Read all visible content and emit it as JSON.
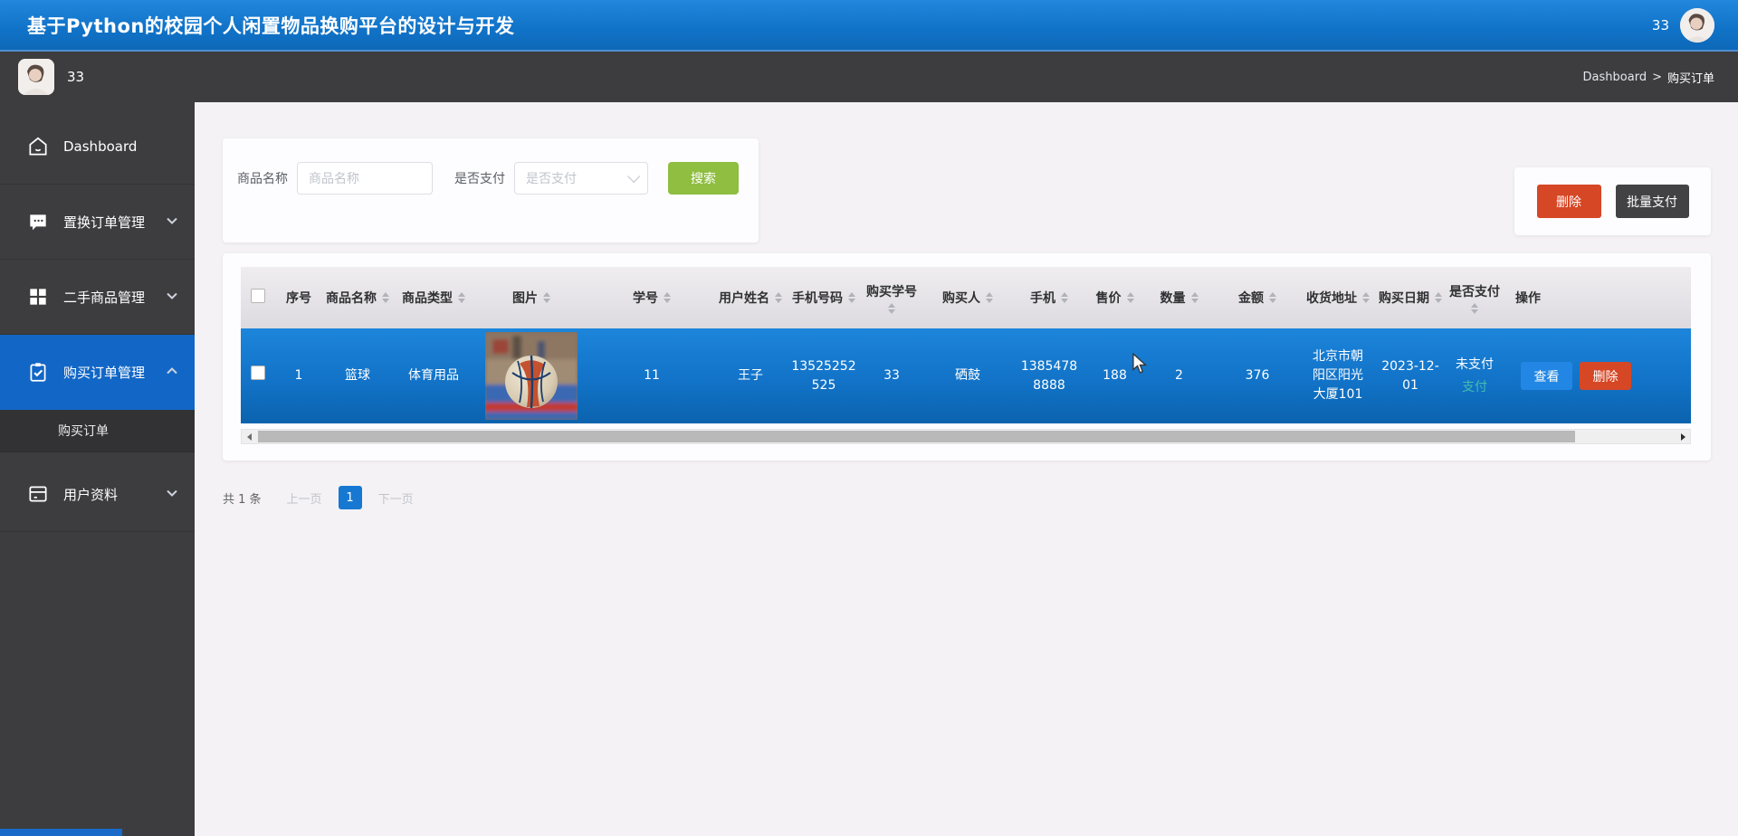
{
  "app": {
    "title": "基于Python的校园个人闲置物品换购平台的设计与开发"
  },
  "header": {
    "username": "33"
  },
  "topbar": {
    "username": "33",
    "breadcrumb_root": "Dashboard",
    "breadcrumb_sep": ">",
    "breadcrumb_current": "购买订单"
  },
  "sidebar": {
    "items": [
      {
        "label": "Dashboard",
        "icon": "home-icon",
        "expandable": false,
        "active": false
      },
      {
        "label": "置换订单管理",
        "icon": "chat-icon",
        "expandable": true,
        "active": false
      },
      {
        "label": "二手商品管理",
        "icon": "grid-icon",
        "expandable": true,
        "active": false
      },
      {
        "label": "购买订单管理",
        "icon": "clipboard-check-icon",
        "expandable": true,
        "active": true
      },
      {
        "label": "用户资料",
        "icon": "card-icon",
        "expandable": true,
        "active": false
      }
    ],
    "submenu": [
      {
        "label": "购买订单"
      }
    ]
  },
  "filters": {
    "name_label": "商品名称",
    "name_placeholder": "商品名称",
    "pay_label": "是否支付",
    "pay_placeholder": "是否支付",
    "search_button": "搜索"
  },
  "bulk_actions": {
    "delete_button": "删除",
    "batch_pay_button": "批量支付"
  },
  "table": {
    "columns": [
      {
        "label": "",
        "sortable": false
      },
      {
        "label": "序号",
        "sortable": false
      },
      {
        "label": "商品名称",
        "sortable": true
      },
      {
        "label": "商品类型",
        "sortable": true
      },
      {
        "label": "图片",
        "sortable": true
      },
      {
        "label": "学号",
        "sortable": true
      },
      {
        "label": "用户姓名",
        "sortable": true
      },
      {
        "label": "手机号码",
        "sortable": true
      },
      {
        "label": "购买学号",
        "sortable": true
      },
      {
        "label": "购买人",
        "sortable": true
      },
      {
        "label": "手机",
        "sortable": true
      },
      {
        "label": "售价",
        "sortable": true
      },
      {
        "label": "数量",
        "sortable": true
      },
      {
        "label": "金额",
        "sortable": true
      },
      {
        "label": "收货地址",
        "sortable": true
      },
      {
        "label": "购买日期",
        "sortable": true
      },
      {
        "label": "是否支付",
        "sortable": true
      },
      {
        "label": "操作",
        "sortable": false
      }
    ],
    "row": {
      "index": "1",
      "product_name": "篮球",
      "product_type": "体育用品",
      "student_no": "11",
      "user_name": "王子",
      "phone": "13525252525",
      "buy_student_no": "33",
      "buyer": "硒鼓",
      "buyer_phone": "13854788888",
      "price": "188",
      "quantity": "2",
      "amount": "376",
      "address": "北京市朝阳区阳光大厦101",
      "date": "2023-12-01",
      "pay_status": "未支付",
      "pay_link": "支付",
      "view_button": "查看",
      "delete_button": "删除"
    }
  },
  "pagination": {
    "total": "共 1 条",
    "prev": "上一页",
    "page": "1",
    "next": "下一页"
  },
  "colors": {
    "header_blue": "#1174c9",
    "active_menu_blue": "#1267c6",
    "row_blue": "#1273c8",
    "danger_red": "#d64726",
    "search_green": "#8fbe41",
    "dark_button": "#424244",
    "pay_link_teal": "#4ecbaa"
  }
}
